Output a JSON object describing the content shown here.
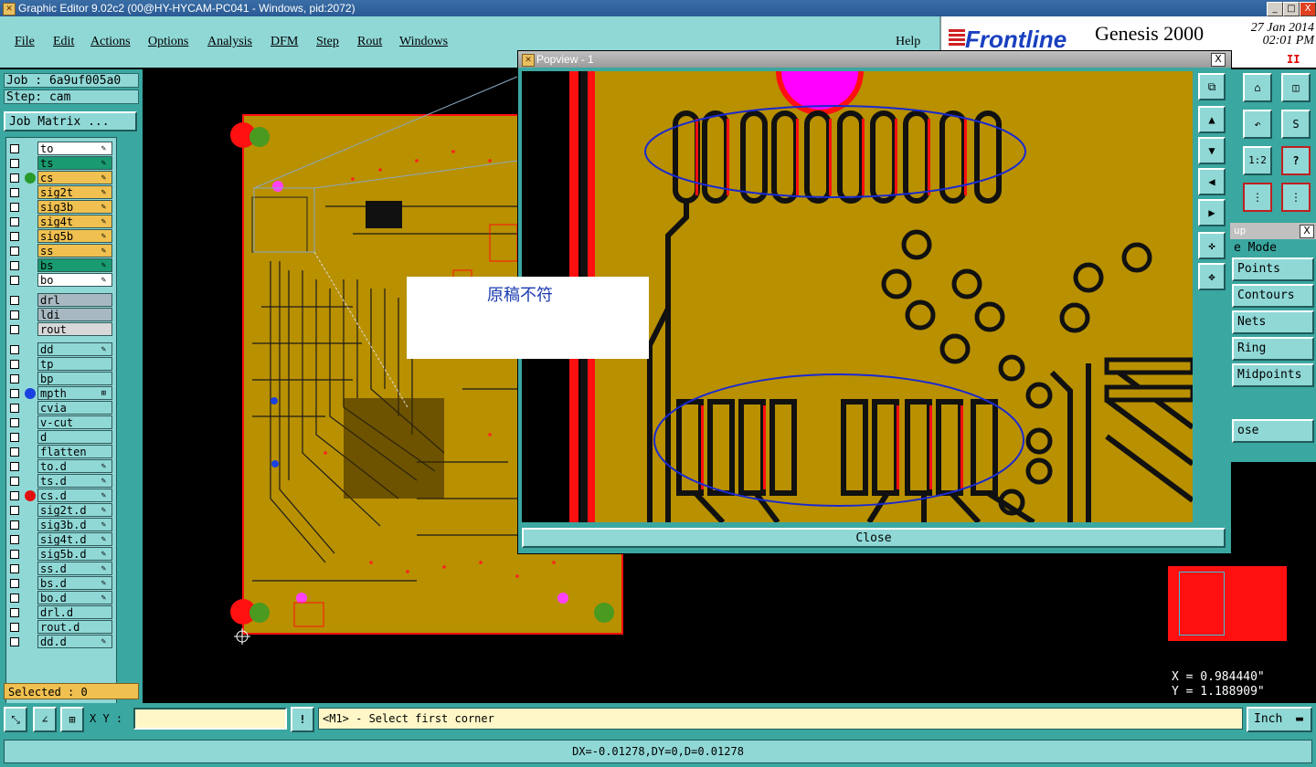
{
  "window": {
    "title": "Graphic Editor 9.02c2 (00@HY-HYCAM-PC041 - Windows, pid:2072)",
    "minimize": "_",
    "maximize": "□",
    "close": "X"
  },
  "menu": {
    "items": [
      "File",
      "Edit",
      "Actions",
      "Options",
      "Analysis",
      "DFM",
      "Step",
      "Rout",
      "Windows"
    ],
    "help": "Help"
  },
  "brand": {
    "logo": "Frontline",
    "product": "Genesis 2000",
    "date": "27 Jan 2014",
    "time": "02:01 PM",
    "pause": "II"
  },
  "job": {
    "job_label": "Job : 6a9uf005a0",
    "step_label": "Step: cam",
    "matrix_button": "Job Matrix ..."
  },
  "layers": [
    {
      "name": "to",
      "bg": "#ffffff",
      "dot": "",
      "mark": "✎"
    },
    {
      "name": "ts",
      "bg": "#1a9a70",
      "dot": "",
      "mark": "✎"
    },
    {
      "name": "cs",
      "bg": "#f0c050",
      "dot": "#2a9a2a",
      "mark": "✎"
    },
    {
      "name": "sig2t",
      "bg": "#f0c050",
      "dot": "",
      "mark": "✎"
    },
    {
      "name": "sig3b",
      "bg": "#f0c050",
      "dot": "",
      "mark": "✎"
    },
    {
      "name": "sig4t",
      "bg": "#f0c050",
      "dot": "",
      "mark": "✎"
    },
    {
      "name": "sig5b",
      "bg": "#f0c050",
      "dot": "",
      "mark": "✎"
    },
    {
      "name": "ss",
      "bg": "#f0c050",
      "dot": "",
      "mark": "✎"
    },
    {
      "name": "bs",
      "bg": "#1a9a70",
      "dot": "",
      "mark": "✎"
    },
    {
      "name": "bo",
      "bg": "#ffffff",
      "dot": "",
      "mark": "✎"
    },
    {
      "name": "drl",
      "bg": "#a8b8c0",
      "dot": "",
      "mark": ""
    },
    {
      "name": "ldi",
      "bg": "#a8b8c0",
      "dot": "",
      "mark": ""
    },
    {
      "name": "rout",
      "bg": "#d8d8d8",
      "dot": "",
      "mark": ""
    },
    {
      "name": "dd",
      "bg": "#8fd8d6",
      "dot": "",
      "mark": "✎"
    },
    {
      "name": "tp",
      "bg": "#8fd8d6",
      "dot": "",
      "mark": ""
    },
    {
      "name": "bp",
      "bg": "#8fd8d6",
      "dot": "",
      "mark": ""
    },
    {
      "name": "mpth",
      "bg": "#8fd8d6",
      "dot": "#1a40e0",
      "mark": "⊞"
    },
    {
      "name": "cvia",
      "bg": "#8fd8d6",
      "dot": "",
      "mark": ""
    },
    {
      "name": "v-cut",
      "bg": "#8fd8d6",
      "dot": "",
      "mark": ""
    },
    {
      "name": "d",
      "bg": "#8fd8d6",
      "dot": "",
      "mark": ""
    },
    {
      "name": "flatten",
      "bg": "#8fd8d6",
      "dot": "",
      "mark": ""
    },
    {
      "name": "to.d",
      "bg": "#8fd8d6",
      "dot": "",
      "mark": "✎"
    },
    {
      "name": "ts.d",
      "bg": "#8fd8d6",
      "dot": "",
      "mark": "✎"
    },
    {
      "name": "cs.d",
      "bg": "#8fd8d6",
      "dot": "#e01010",
      "mark": "✎"
    },
    {
      "name": "sig2t.d",
      "bg": "#8fd8d6",
      "dot": "",
      "mark": "✎"
    },
    {
      "name": "sig3b.d",
      "bg": "#8fd8d6",
      "dot": "",
      "mark": "✎"
    },
    {
      "name": "sig4t.d",
      "bg": "#8fd8d6",
      "dot": "",
      "mark": "✎"
    },
    {
      "name": "sig5b.d",
      "bg": "#8fd8d6",
      "dot": "",
      "mark": "✎"
    },
    {
      "name": "ss.d",
      "bg": "#8fd8d6",
      "dot": "",
      "mark": "✎"
    },
    {
      "name": "bs.d",
      "bg": "#8fd8d6",
      "dot": "",
      "mark": "✎"
    },
    {
      "name": "bo.d",
      "bg": "#8fd8d6",
      "dot": "",
      "mark": "✎"
    },
    {
      "name": "drl.d",
      "bg": "#8fd8d6",
      "dot": "",
      "mark": ""
    },
    {
      "name": "rout.d",
      "bg": "#8fd8d6",
      "dot": "",
      "mark": ""
    },
    {
      "name": "dd.d",
      "bg": "#8fd8d6",
      "dot": "",
      "mark": "✎"
    }
  ],
  "selected": "Selected : 0",
  "popview": {
    "title": "Popview - 1",
    "close_x": "X",
    "close_button": "Close"
  },
  "note": "原稿不符",
  "snap_panel": {
    "title": "up",
    "close_x": "X",
    "mode_label": "e Mode",
    "modes": [
      "Points",
      "Contours",
      "Nets",
      "Ring",
      "Midpoints"
    ],
    "close": "ose"
  },
  "toolbar_icons": [
    "home-icon",
    "window-icon",
    "undo-icon",
    "redraw-icon",
    "ratio-icon",
    "help-icon"
  ],
  "toolbar_ratio": "1:2",
  "toolbar_help": "?",
  "coords": {
    "x": "X = 0.984440\"",
    "y": "Y = 1.188909\""
  },
  "bottom": {
    "xy_label": "X Y :",
    "exclaim": "!",
    "message": "<M1> - Select first corner",
    "unit": "Inch"
  },
  "status": "DX=-0.01278,DY=0,D=0.01278",
  "colors": {
    "teal": "#3aa7a0",
    "light_teal": "#8fd8d6",
    "board": "#b89000",
    "copper_edge": "#ff1010"
  }
}
